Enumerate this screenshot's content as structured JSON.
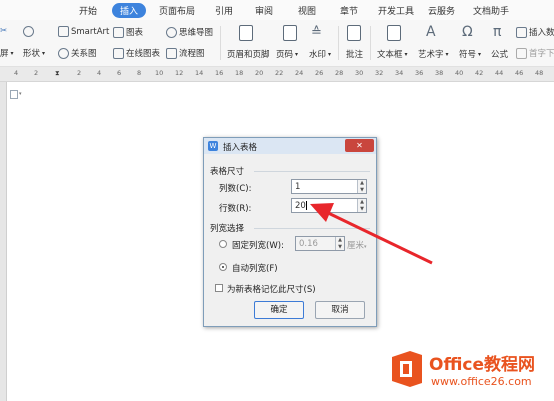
{
  "menu_tabs": [
    "开始",
    "插入",
    "页面布局",
    "引用",
    "审阅",
    "视图",
    "章节",
    "开发工具",
    "云服务",
    "文档助手"
  ],
  "active_tab": "插入",
  "ribbon": {
    "screen": "屏",
    "shape": "形状",
    "smartart": "SmartArt",
    "relation": "关系图",
    "chart": "图表",
    "online_chart": "在线图表",
    "mindmap": "思维导图",
    "flowchart": "流程图",
    "header_footer": "页眉和页脚",
    "page_number": "页码",
    "watermark_btn": "水印",
    "comment": "批注",
    "textbox": "文本框",
    "wordart": "艺术字",
    "symbol": "符号",
    "formula": "公式",
    "insert_num": "插入数",
    "first_char": "首字下"
  },
  "ruler_ticks": [
    "4",
    "2",
    "2",
    "4",
    "6",
    "8",
    "10",
    "12",
    "14",
    "16",
    "18",
    "20",
    "22",
    "24",
    "26",
    "28",
    "30",
    "32",
    "34",
    "36",
    "38",
    "40",
    "42",
    "44",
    "46",
    "48"
  ],
  "dialog": {
    "title": "插入表格",
    "close_symbol": "✕",
    "group_size": "表格尺寸",
    "columns_label": "列数(C):",
    "columns_value": "1",
    "rows_label": "行数(R):",
    "rows_value": "20",
    "group_width": "列宽选择",
    "fixed_width_label": "固定列宽(W):",
    "fixed_width_value": "0.16",
    "fixed_width_unit": "厘米",
    "auto_width_label": "自动列宽(F)",
    "remember_label": "为新表格记忆此尺寸(S)",
    "ok": "确定",
    "cancel": "取消",
    "auto_width_selected": true,
    "remember_checked": false
  },
  "watermark": {
    "brand": "Office教程网",
    "url": "www.office26.com"
  },
  "colors": {
    "accent": "#3d83dd",
    "arrow": "#e8262b",
    "logo": "#e9531f"
  }
}
